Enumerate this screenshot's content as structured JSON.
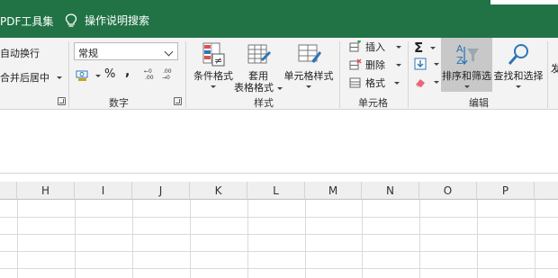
{
  "header": {
    "tab_pdf": "PDF工具集",
    "tell_me": "操作说明搜索"
  },
  "ribbon": {
    "alignment": {
      "wrap_text": "自动换行",
      "merge_center": "合并后居中"
    },
    "number": {
      "format_value": "常规",
      "percent": "%",
      "comma": ",",
      "group_label": "数字"
    },
    "styles": {
      "conditional": "条件格式",
      "format_table_1": "套用",
      "format_table_2": "表格格式",
      "cell_styles": "单元格样式",
      "group_label": "样式"
    },
    "cells": {
      "insert": "插入",
      "delete": "删除",
      "format": "格式",
      "group_label": "单元格"
    },
    "editing": {
      "sort_filter": "排序和筛选",
      "find_select": "查找和选择",
      "group_label": "编辑",
      "next_group_partial": "发"
    }
  },
  "grid": {
    "columns": [
      "H",
      "I",
      "J",
      "K",
      "L",
      "M",
      "N",
      "O",
      "P"
    ]
  },
  "colors": {
    "brand_green": "#217346",
    "ribbon_bg": "#f3f3f3",
    "pressed": "#c8c8c8"
  }
}
